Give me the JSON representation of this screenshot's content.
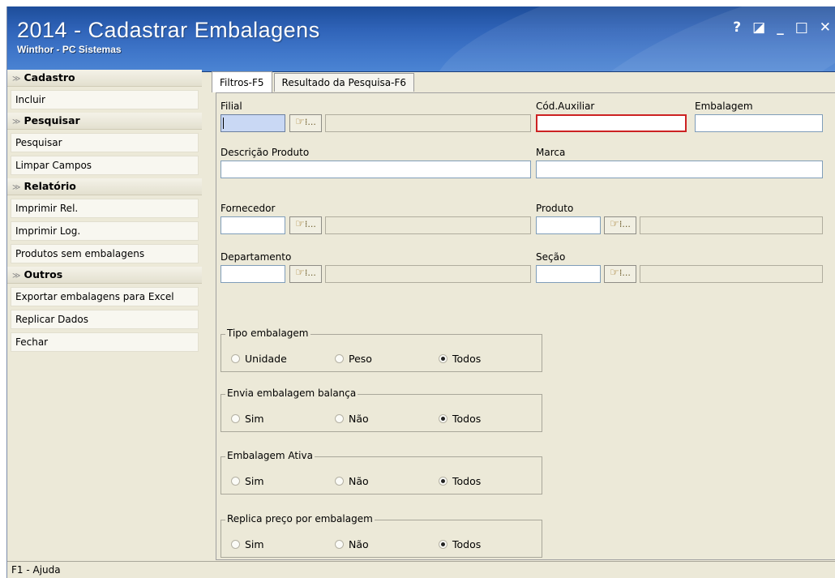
{
  "window": {
    "title": "2014 - Cadastrar Embalagens",
    "subtitle": "Winthor - PC Sistemas",
    "controls": [
      "?",
      "◪",
      "_",
      "□",
      "✕"
    ]
  },
  "sidebar": {
    "sections": [
      {
        "title": "Cadastro",
        "items": [
          "Incluir"
        ]
      },
      {
        "title": "Pesquisar",
        "items": [
          "Pesquisar",
          "Limpar Campos"
        ]
      },
      {
        "title": "Relatório",
        "items": [
          "Imprimir Rel.",
          "Imprimir Log.",
          "Produtos sem embalagens"
        ]
      },
      {
        "title": "Outros",
        "items": [
          "Exportar embalagens para Excel",
          "Replicar Dados",
          "Fechar"
        ]
      }
    ]
  },
  "tabs": [
    "Filtros-F5",
    "Resultado da Pesquisa-F6"
  ],
  "fields": {
    "filial": {
      "label": "Filial",
      "value": ""
    },
    "cod_auxiliar": {
      "label": "Cód.Auxiliar",
      "value": ""
    },
    "embalagem": {
      "label": "Embalagem",
      "value": ""
    },
    "descricao_produto": {
      "label": "Descrição Produto",
      "value": ""
    },
    "marca": {
      "label": "Marca",
      "value": ""
    },
    "fornecedor": {
      "label": "Fornecedor",
      "value": ""
    },
    "produto": {
      "label": "Produto",
      "value": ""
    },
    "departamento": {
      "label": "Departamento",
      "value": ""
    },
    "secao": {
      "label": "Seção",
      "value": ""
    }
  },
  "lookup_button": {
    "icon": "hand-pointer-icon",
    "glyph": "☞",
    "dots": "⁞..."
  },
  "groups": [
    {
      "title": "Tipo embalagem",
      "options": [
        "Unidade",
        "Peso",
        "Todos"
      ],
      "selected": "Todos"
    },
    {
      "title": "Envia embalagem balança",
      "options": [
        "Sim",
        "Não",
        "Todos"
      ],
      "selected": "Todos"
    },
    {
      "title": "Embalagem Ativa",
      "options": [
        "Sim",
        "Não",
        "Todos"
      ],
      "selected": "Todos"
    },
    {
      "title": "Replica preço por embalagem",
      "options": [
        "Sim",
        "Não",
        "Todos"
      ],
      "selected": "Todos"
    }
  ],
  "status": "F1 - Ajuda",
  "colors": {
    "title_bar": "#2f63b8",
    "highlight_input": "#c9d8f4",
    "required_border": "#cc2222"
  }
}
